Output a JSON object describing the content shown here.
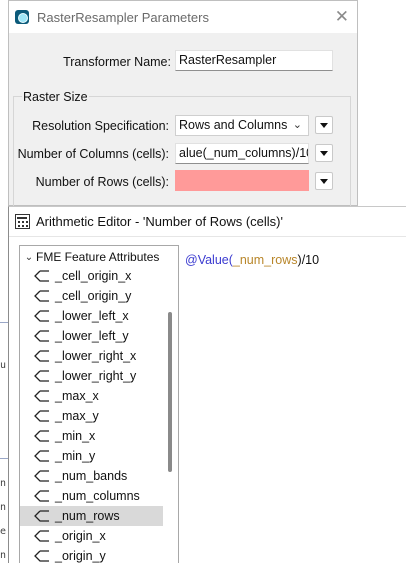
{
  "params_dialog": {
    "title": "RasterResampler Parameters",
    "close_glyph": "✕",
    "transformer_name_label": "Transformer Name:",
    "transformer_name_value": "RasterResampler",
    "group_title": "Raster Size",
    "resolution_spec_label": "Resolution Specification:",
    "resolution_spec_value": "Rows and Columns",
    "num_columns_label": "Number of Columns (cells):",
    "num_columns_value": "alue(_num_columns)/10",
    "num_rows_label": "Number of Rows (cells):",
    "num_rows_value": "",
    "num_rows_color": "#ff9a99",
    "icons": {
      "app": "fme-app-icon",
      "close": "close-icon",
      "dropdown": "chevron-down-icon",
      "menu": "triangle-menu-icon"
    }
  },
  "arith_dialog": {
    "title": "Arithmetic Editor - 'Number of Rows (cells)'",
    "tree_header": "FME Feature Attributes",
    "attributes": [
      "_cell_origin_x",
      "_cell_origin_y",
      "_lower_left_x",
      "_lower_left_y",
      "_lower_right_x",
      "_lower_right_y",
      "_max_x",
      "_max_y",
      "_min_x",
      "_min_y",
      "_num_bands",
      "_num_columns",
      "_num_rows",
      "_origin_x",
      "_origin_y"
    ],
    "selected_attribute": "_num_rows",
    "expression": {
      "func": "@Value(",
      "attr": "_num_rows",
      "rest": ")/10"
    },
    "colors": {
      "func": "#3b3bd0",
      "attr": "#b8862a",
      "selection": "#d9d9d9"
    }
  },
  "background_fragments": [
    "n",
    "n",
    "e",
    "n"
  ]
}
